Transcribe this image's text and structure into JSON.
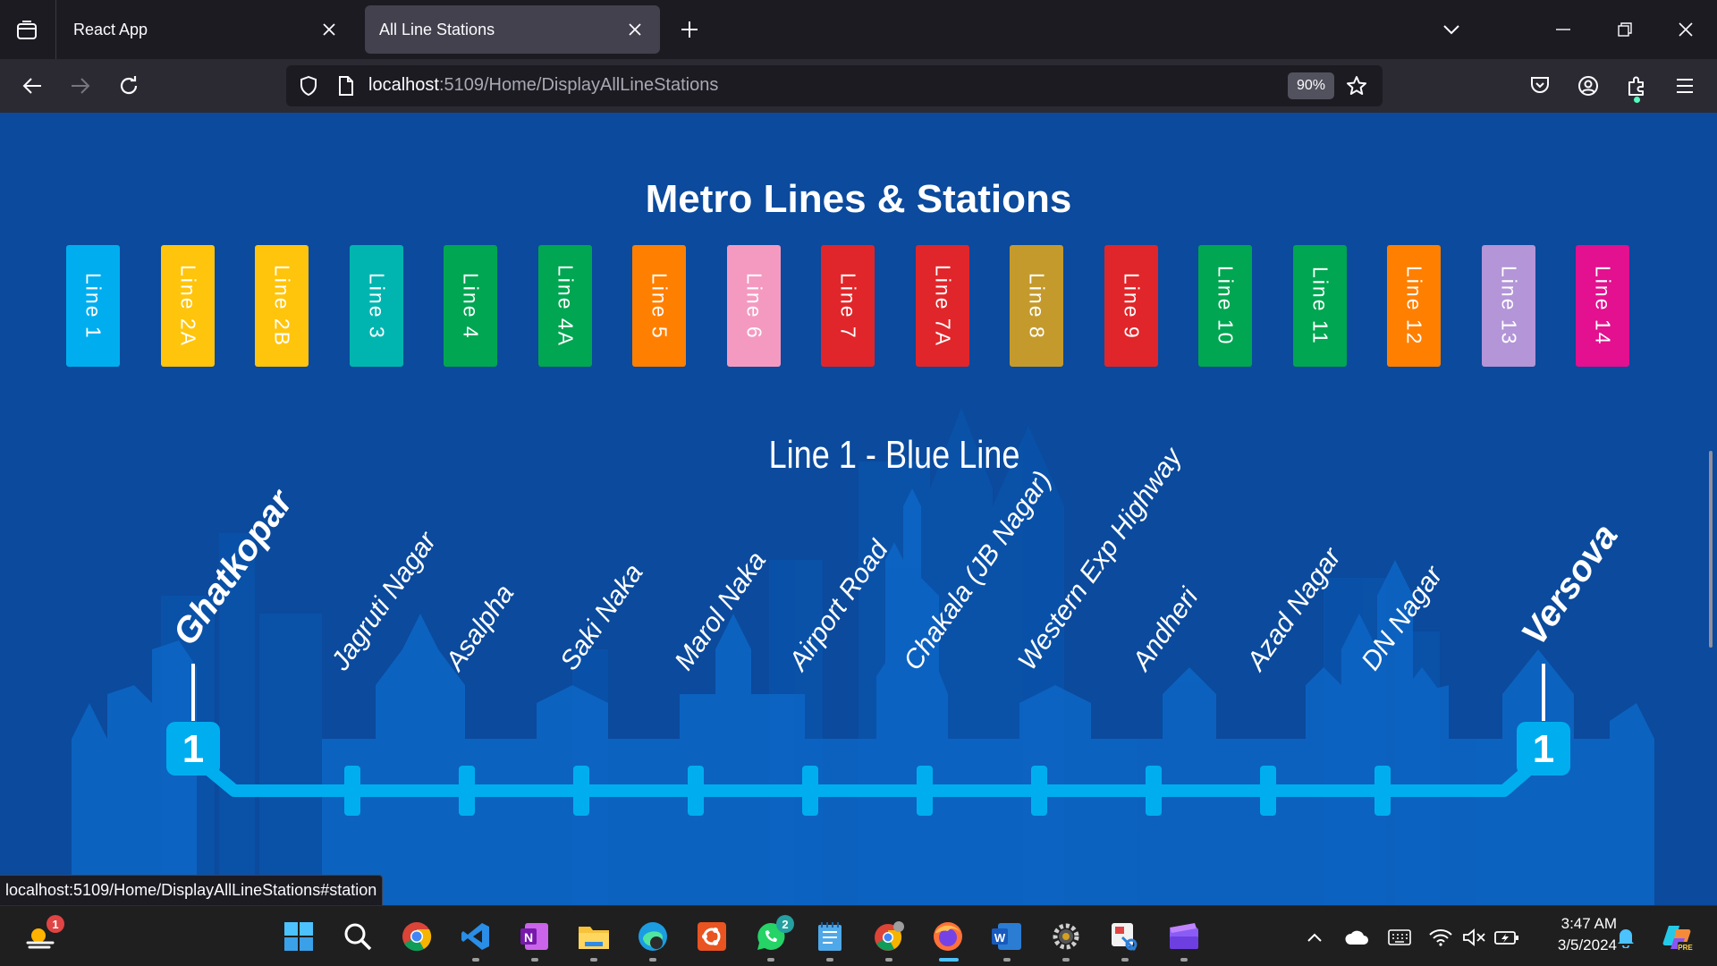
{
  "browser": {
    "tabs": [
      {
        "title": "React App",
        "active": false
      },
      {
        "title": "All Line Stations",
        "active": true
      }
    ],
    "url_host": "localhost",
    "url_rest": ":5109/Home/DisplayAllLineStations",
    "zoom": "90%",
    "status_url": "localhost:5109/Home/DisplayAllLineStations#station"
  },
  "page": {
    "heading": "Metro Lines & Stations",
    "lines": [
      {
        "label": "Line 1",
        "color": "#00aeef"
      },
      {
        "label": "Line 2A",
        "color": "#ffc40c"
      },
      {
        "label": "Line 2B",
        "color": "#ffc40c"
      },
      {
        "label": "Line 3",
        "color": "#00b5b0"
      },
      {
        "label": "Line 4",
        "color": "#00a651"
      },
      {
        "label": "Line 4A",
        "color": "#00a651"
      },
      {
        "label": "Line 5",
        "color": "#ff7f00"
      },
      {
        "label": "Line 6",
        "color": "#f49ac1"
      },
      {
        "label": "Line 7",
        "color": "#e0262a"
      },
      {
        "label": "Line 7A",
        "color": "#e0262a"
      },
      {
        "label": "Line 8",
        "color": "#c49a2c"
      },
      {
        "label": "Line 9",
        "color": "#e0262a"
      },
      {
        "label": "Line 10",
        "color": "#00a651"
      },
      {
        "label": "Line 11",
        "color": "#00a651"
      },
      {
        "label": "Line 12",
        "color": "#ff7f00"
      },
      {
        "label": "Line 13",
        "color": "#b395d8"
      },
      {
        "label": "Line 14",
        "color": "#e3108f"
      }
    ],
    "map": {
      "title": "Line 1 - Blue Line",
      "line_color": "#00aeef",
      "line_number": "1",
      "terminal_start": "Ghatkopar",
      "terminal_end": "Versova",
      "stations": [
        "Jagruti Nagar",
        "Asalpha",
        "Saki Naka",
        "Marol Naka",
        "Airport Road",
        "Chakala (JB Nagar)",
        "Western Exp Highway",
        "Andheri",
        "Azad Nagar",
        "DN Nagar"
      ]
    }
  },
  "taskbar": {
    "time": "3:47 AM",
    "date": "3/5/2024",
    "badges": {
      "weather": "1",
      "whatsapp": "2"
    }
  }
}
